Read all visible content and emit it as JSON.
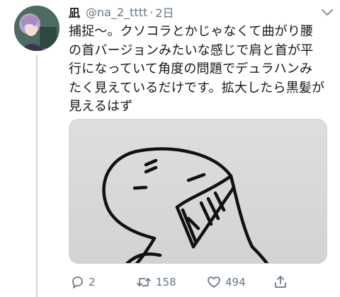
{
  "tweet": {
    "display_name": "凪",
    "handle": "@na_2_tttt",
    "separator": "·",
    "time": "2日",
    "text": "捕捉〜。クソコラとかじゃなくて曲がり腰の首バージョンみたいな感じで肩と首が平行になっていて角度の問題でデュラハンみたく見えているだけです。拡大したら黒髪が見えるはず"
  },
  "actions": {
    "reply_count": "2",
    "retweet_count": "158",
    "like_count": "494"
  },
  "icons": {
    "reply": "reply-icon",
    "retweet": "retweet-icon",
    "like": "heart-icon",
    "share": "share-icon",
    "menu": "chevron-down-icon"
  },
  "colors": {
    "text": "#14171a",
    "secondary": "#657786",
    "thread_line": "#ccd6dd"
  }
}
